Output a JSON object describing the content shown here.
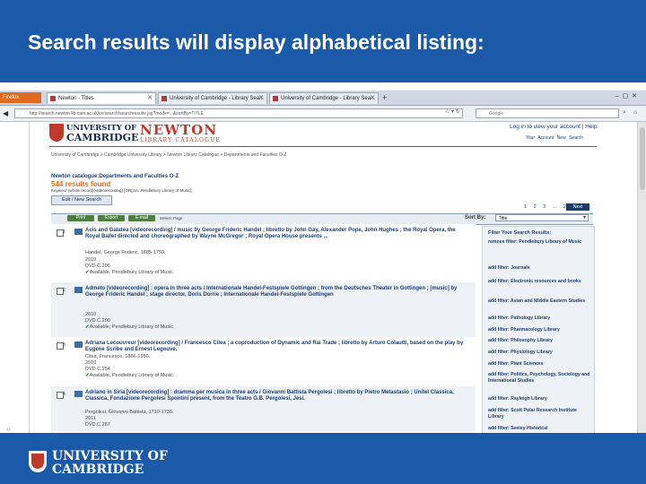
{
  "slide": {
    "title": "Search results will display alphabetical listing:",
    "footer_logo_line1": "UNIVERSITY OF",
    "footer_logo_line2": "CAMBRIDGE"
  },
  "browser": {
    "app_tab": "Firefox",
    "tabs": [
      {
        "label": "Newton - Titles"
      },
      {
        "label": "University of Cambridge - Library Sea..."
      },
      {
        "label": "University of Cambridge - Library Sea..."
      }
    ],
    "url": "http://search.newton.lib.cam.ac.uk/ve/search/searchresults.jsp?mode=...&sortBy=TITLE",
    "search_placeholder": "Google"
  },
  "site": {
    "cam_line1": "UNIVERSITY OF",
    "cam_line2": "CAMBRIDGE",
    "newton_main": "NEWTON",
    "newton_sub": "LIBRARY CATALOGUE",
    "login": "Log in to view your account | Help",
    "top_links": "Your Account  New Search",
    "breadcrumb": "University of Cambridge > Cambridge University Library > Newton Library Catalogue > Departments and Faculties O-Z"
  },
  "results_header": {
    "heading": "Newton catalogue:Departments and Faculties O-Z",
    "count": "544 results found",
    "keyword": "Keyword (whole record)(videorecording) [OR(UA: Pendlebury Library of Music]",
    "edit_button": "Edit / New Search"
  },
  "toolbar": {
    "print": "Print",
    "export": "Export",
    "email": "E-mail",
    "select_text": "Select:  Page",
    "sort_label": "Sort By:",
    "sort_value": "Title",
    "pager": "1  2  3 ...  22",
    "next": "Next"
  },
  "results": [
    {
      "num": "1",
      "title": "Acis and Galatea [videorecording] / music by George Frideric Handel ; libretto by John Gay, Alexander Pope, John Hughes ; the Royal Opera, the Royal Ballet directed and choreographed by Wayne McGregor ; Royal Opera House presents ...",
      "author": "Handel, George Frideric, 1685-1759.",
      "year": "2010",
      "call": "DVD.C.205",
      "avail": "Available, Pendlebury Library of Music"
    },
    {
      "num": "2",
      "title": "Admeto [videorecording] : opera in three acts / Internationale Handel-Festspiele Gottingen ; from the Deutsches Theater in Gottingen ; [music] by George Frideric Handel ; stage director, Doris Dorrie ; Internationale Handel-Festspiele Gottingen",
      "author": "",
      "year": "2010",
      "call": "DVD.C.200",
      "avail": "Available, Pendlebury Library of Music"
    },
    {
      "num": "3",
      "title": "Adriana Lecouvreur [videorecording] / Francesco Cilea ; a coproduction of Dynamic and Rai Trade ; libretto by Arturo Colautti, based on the play by Eugene Scribe and Ernest Legouve.",
      "author": "Cilea, Francesco, 1866-1950.",
      "year": "2010",
      "call": "DVD.C.254",
      "avail": "Available, Pendlebury Library of Music"
    },
    {
      "num": "4",
      "title": "Adriano in Siria [videorecording] : dramma per musica in three acts / Giovanni Battista Pergolesi ; libretto by Pietro Metastasio ; Unitel Classica, Classica, Fondazione Pergolesi Spontini present, from the Teatro G.B. Pergolesi, Jesi.",
      "author": "Pergolesi, Giovanni Battista, 1710-1736.",
      "year": "2011",
      "call": "DVD.C.287",
      "avail": ""
    }
  ],
  "filters": {
    "title": "Filter Your Search Results:",
    "items": [
      "remove filter: Pendlebury Library of Music",
      "add filter: Journals",
      "add filter: Electronic resources and books",
      "add filter: Asian and Middle Eastern Studies",
      "add filter: Pathology Library",
      "add filter: Pharmacology Library",
      "add filter: Philosophy Library",
      "add filter: Physiology Library",
      "add filter: Plant Sciences",
      "add filter: Politics, Psychology, Sociology and International Studies",
      "add filter: Rayleigh Library",
      "add filter: Scott Polar Research Institute Library",
      "add filter: Seeley Historical"
    ]
  }
}
